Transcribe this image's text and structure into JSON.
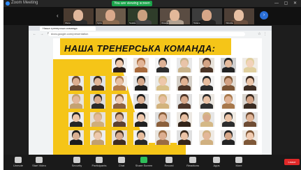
{
  "window": {
    "app_title": "Zoom Meeting",
    "controls": "— ▢ ✕"
  },
  "share_banner": {
    "label": "You are viewing screen"
  },
  "participants": [
    {
      "name": "Olena",
      "bg": "#4a3b30",
      "skin": "#e0b79b",
      "shirt": "#2d2d2d"
    },
    {
      "name": "Iryna",
      "bg": "#6b5a4a",
      "skin": "#d9a98c",
      "shirt": "#8a6a50"
    },
    {
      "name": "Natalia",
      "bg": "#2f3d2a",
      "skin": "#caa07f",
      "shirt": "#444444"
    },
    {
      "name": "Oksana",
      "bg": "#5a4c42",
      "skin": "#e3b89a",
      "shirt": "#b0a090"
    },
    {
      "name": "Tetiana",
      "bg": "#3c3c3c",
      "skin": "#d6a688",
      "shirt": "#222222"
    },
    {
      "name": "Viktoriia",
      "bg": "#4d3f36",
      "skin": "#e6bfa3",
      "shirt": "#6a4f3f"
    }
  ],
  "browser": {
    "tab_title": "Наша тренерська команда",
    "url": "docs.google.com/presentation",
    "nav": "← → ↻",
    "extensions": "☆ ⋮"
  },
  "slide": {
    "title": "НАША ТРЕНЕРСЬКА КОМАНДА:",
    "accent_color": "#f5c518"
  },
  "photos": [
    {
      "skin": "#f0cfb4",
      "hair": "#d9c28f",
      "bg": "#ece6dc"
    },
    {
      "skin": "#e7bea0",
      "hair": "#3b2a20",
      "bg": "#d8d2c8"
    },
    {
      "skin": "#d8ad90",
      "hair": "#5a4030",
      "bg": "#9aa0a0"
    },
    {
      "skin": "#efc9ad",
      "hair": "#2a1d18",
      "bg": "#f1f1f1"
    },
    {
      "skin": "#e3b597",
      "hair": "#a86a3c",
      "bg": "#ede4dc"
    },
    {
      "skin": "#ddb195",
      "hair": "#2c2c2c",
      "bg": "#f4f4f4"
    },
    {
      "skin": "#e9c4a8",
      "hair": "#c9b38a",
      "bg": "#e9e9e9"
    },
    {
      "skin": "#d4a485",
      "hair": "#4a3426",
      "bg": "#e7e2da"
    },
    {
      "skin": "#e5bb9d",
      "hair": "#222222",
      "bg": "#cfcfcf"
    },
    {
      "skin": "#f2d2ba",
      "hair": "#e0cf9e",
      "bg": "#f0ece6"
    },
    {
      "skin": "#dcae90",
      "hair": "#6b4a32",
      "bg": "#eaeaea"
    },
    {
      "skin": "#e1b698",
      "hair": "#3a2a22",
      "bg": "#dfe3e6"
    },
    {
      "skin": "#e8c0a2",
      "hair": "#b37b4a",
      "bg": "#f3efe9"
    },
    {
      "skin": "#d6a98b",
      "hair": "#1f1f1f",
      "bg": "#e6e6e6"
    },
    {
      "skin": "#eec7aa",
      "hair": "#d8c088",
      "bg": "#ecebe8"
    },
    {
      "skin": "#dfb293",
      "hair": "#4b3528",
      "bg": "#d5d0c8"
    },
    {
      "skin": "#e6bc9e",
      "hair": "#2b2b2b",
      "bg": "#f2f2f2"
    },
    {
      "skin": "#d3a283",
      "hair": "#7a5434",
      "bg": "#e3ddd5"
    },
    {
      "skin": "#ebc5a8",
      "hair": "#3e2e24",
      "bg": "#ededed"
    },
    {
      "skin": "#e2b79a",
      "hair": "#c4a272",
      "bg": "#e8e4de"
    },
    {
      "skin": "#d9ab8d",
      "hair": "#2a2a2a",
      "bg": "#dcdcdc"
    },
    {
      "skin": "#f0cbb0",
      "hair": "#8c6240",
      "bg": "#f1ede7"
    },
    {
      "skin": "#ddb092",
      "hair": "#1e1e1e",
      "bg": "#e4e4e4"
    },
    {
      "skin": "#e7bf9f",
      "hair": "#d2b27c",
      "bg": "#efeae3"
    },
    {
      "skin": "#d7a88a",
      "hair": "#4d362a",
      "bg": "#e1e1e1"
    },
    {
      "skin": "#eac2a5",
      "hair": "#2f2f2f",
      "bg": "#ebe7e1"
    },
    {
      "skin": "#e0b395",
      "hair": "#a7784c",
      "bg": "#f0f0f0"
    },
    {
      "skin": "#d5a587",
      "hair": "#3a2b21",
      "bg": "#dad6d0"
    },
    {
      "skin": "#ecc6a9",
      "hair": "#262626",
      "bg": "#eeeeee"
    },
    {
      "skin": "#e4b999",
      "hair": "#cfae7a",
      "bg": "#e6e1da"
    },
    {
      "skin": "#dbad8f",
      "hair": "#5b4030",
      "bg": "#e9e9e9"
    },
    {
      "skin": "#efc8ab",
      "hair": "#202020",
      "bg": "#f2eee8"
    },
    {
      "skin": "#dfb497",
      "hair": "#8a5f3c",
      "bg": "#dedede"
    },
    {
      "skin": "#e8bfa1",
      "hair": "#332419",
      "bg": "#ece8e2"
    },
    {
      "skin": "#d8aa8c",
      "hair": "#d4b886",
      "bg": "#e7e7e7"
    },
    {
      "skin": "#ecc4a6",
      "hair": "#2d2d2d",
      "bg": "#f0ebe4"
    },
    {
      "skin": "#e1b597",
      "hair": "#6e4c34",
      "bg": "#e2e2e2"
    },
    {
      "skin": "#dab092",
      "hair": "#1c1c1c",
      "bg": "#eae6e0"
    },
    {
      "skin": "#eec9ad",
      "hair": "#c2a070",
      "bg": "#ededed"
    },
    {
      "skin": "#d9ac8e",
      "hair": "#402e23",
      "bg": "#e5e0d9"
    },
    {
      "skin": "#e6bc9d",
      "hair": "#292929",
      "bg": "#f1f1f1"
    },
    {
      "skin": "#dcae90",
      "hair": "#9a6c44",
      "bg": "#e8e3dc"
    },
    {
      "skin": "#ebc3a6",
      "hair": "#362619",
      "bg": "#e0e0e0"
    },
    {
      "skin": "#e3b798",
      "hair": "#d0b080",
      "bg": "#efebe5"
    },
    {
      "skin": "#d6a789",
      "hair": "#242424",
      "bg": "#e6e6e6"
    },
    {
      "skin": "#f1ccb1",
      "hair": "#7f5838",
      "bg": "#eeeae4"
    },
    {
      "skin": "#deb193",
      "hair": "#1f1f1f",
      "bg": "#e3e3e3"
    },
    {
      "skin": "#e8c0a3",
      "hair": "#c8a676",
      "bg": "#ebe6df"
    },
    {
      "skin": "#d9ab8d",
      "hair": "#3f2d22",
      "bg": "#ececec"
    },
    {
      "skin": "#e4ba9b",
      "hair": "#2c2c2c",
      "bg": "#e7e2db"
    },
    {
      "skin": "#ddb092",
      "hair": "#a57a4e",
      "bg": "#f0f0f0"
    },
    {
      "skin": "#eac3a6",
      "hair": "#302218",
      "bg": "#e4dfd8"
    },
    {
      "skin": "#e0b496",
      "hair": "#262626",
      "bg": "#eeeeee"
    },
    {
      "skin": "#d8aa8c",
      "hair": "#d6ba88",
      "bg": "#e9e4dd"
    },
    {
      "skin": "#efc9ac",
      "hair": "#563d2c",
      "bg": "#e1e1e1"
    },
    {
      "skin": "#e2b699",
      "hair": "#202020",
      "bg": "#f2eee8"
    }
  ],
  "toolbar": {
    "buttons": [
      {
        "label": "Unmute",
        "color": "#cfcfcf"
      },
      {
        "label": "Start Video",
        "color": "#cfcfcf"
      },
      {
        "label": "Security",
        "color": "#cfcfcf"
      },
      {
        "label": "Participants",
        "color": "#cfcfcf"
      },
      {
        "label": "Chat",
        "color": "#cfcfcf"
      },
      {
        "label": "Share Screen",
        "color": "#2fbf5a"
      },
      {
        "label": "Record",
        "color": "#cfcfcf"
      },
      {
        "label": "Reactions",
        "color": "#cfcfcf"
      },
      {
        "label": "Apps",
        "color": "#cfcfcf"
      },
      {
        "label": "More",
        "color": "#cfcfcf"
      }
    ],
    "leave_label": "Leave"
  }
}
